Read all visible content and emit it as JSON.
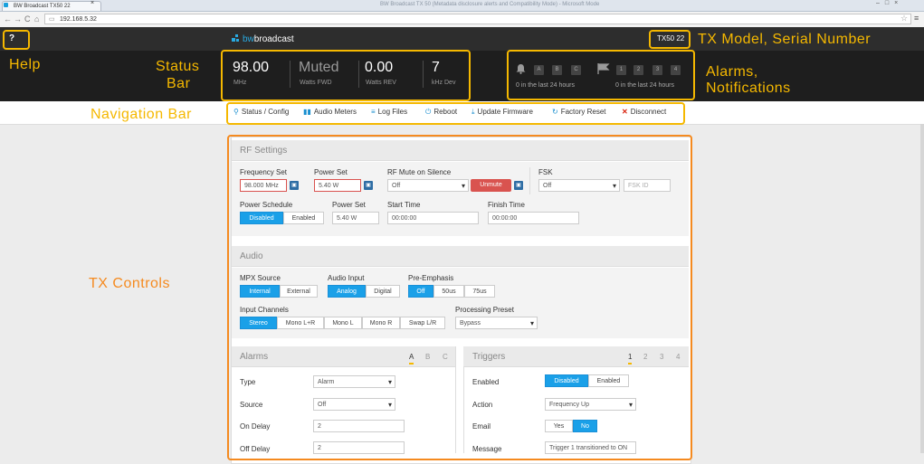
{
  "browser": {
    "tab_title": "BW Broadcast TX50 22",
    "window_title": "BW Broadcast TX 50 (Metadata disclosure alerts and Compatibility Mode) - Microsoft Mode",
    "url": "192.168.5.32",
    "back_glyph": "←",
    "forward_glyph": "→",
    "reload_glyph": "C",
    "home_glyph": "⌂",
    "close_glyph": "×",
    "window_controls": "–□×",
    "star_glyph": "☆",
    "menu_glyph": "≡"
  },
  "header": {
    "help_label": "?",
    "logo_prefix": "bw",
    "logo_suffix": "broadcast",
    "model_serial": "TX50 22"
  },
  "status_bar": {
    "frequency": {
      "value": "98.00",
      "unit": "MHz"
    },
    "forward": {
      "value": "Muted",
      "unit": "Watts FWD"
    },
    "reverse": {
      "value": "0.00",
      "unit": "Watts REV"
    },
    "deviation": {
      "value": "7",
      "unit": "kHz Dev"
    }
  },
  "alarms": {
    "bell_icon": "bell-icon",
    "labels": [
      "A",
      "B",
      "C"
    ],
    "text": "0 in the last 24 hours"
  },
  "notifications": {
    "flag_icon": "flag-icon",
    "labels": [
      "1",
      "2",
      "3",
      "4"
    ],
    "text": "0 in the last 24 hours"
  },
  "nav": {
    "items": [
      {
        "icon": "⚲",
        "label": "Status / Config"
      },
      {
        "icon": "▮▮",
        "label": "Audio Meters"
      },
      {
        "icon": "≡",
        "label": "Log Files"
      },
      {
        "icon": "⏻",
        "label": "Reboot"
      },
      {
        "icon": "⤓",
        "label": "Update Firmware"
      },
      {
        "icon": "↻",
        "label": "Factory Reset"
      },
      {
        "icon": "✕",
        "label": "Disconnect"
      }
    ]
  },
  "rf": {
    "title": "RF Settings",
    "frequency_set_label": "Frequency Set",
    "frequency_set_value": "98.000 MHz",
    "power_set_label": "Power Set",
    "power_set_value": "5.40 W",
    "rf_mute_label": "RF Mute on Silence",
    "rf_mute_value": "Off",
    "unmute_label": "Unmute",
    "fsk_label": "FSK",
    "fsk_value": "Off",
    "fsk_id_placeholder": "FSK ID",
    "power_schedule_label": "Power Schedule",
    "schedule_disabled": "Disabled",
    "schedule_enabled": "Enabled",
    "power_set2_label": "Power Set",
    "power_set2_value": "5.40 W",
    "start_time_label": "Start Time",
    "start_time_value": "00:00:00",
    "finish_time_label": "Finish Time",
    "finish_time_value": "00:00:00"
  },
  "audio": {
    "title": "Audio",
    "mpx_label": "MPX Source",
    "mpx_options": [
      "Internal",
      "External"
    ],
    "input_label": "Audio Input",
    "input_options": [
      "Analog",
      "Digital"
    ],
    "preemph_label": "Pre-Emphasis",
    "preemph_options": [
      "Off",
      "50us",
      "75us"
    ],
    "channels_label": "Input Channels",
    "channels_options": [
      "Stereo",
      "Mono L+R",
      "Mono L",
      "Mono R",
      "Swap L/R"
    ],
    "preset_label": "Processing Preset",
    "preset_value": "Bypass"
  },
  "alarms_panel": {
    "title": "Alarms",
    "tabs": [
      "A",
      "B",
      "C"
    ],
    "type_label": "Type",
    "type_value": "Alarm",
    "source_label": "Source",
    "source_value": "Off",
    "on_delay_label": "On Delay",
    "on_delay_value": "2",
    "off_delay_label": "Off Delay",
    "off_delay_value": "2"
  },
  "triggers_panel": {
    "title": "Triggers",
    "tabs": [
      "1",
      "2",
      "3",
      "4"
    ],
    "enabled_label": "Enabled",
    "enabled_options": [
      "Disabled",
      "Enabled"
    ],
    "action_label": "Action",
    "action_value": "Frequency Up",
    "email_label": "Email",
    "email_options": [
      "Yes",
      "No"
    ],
    "message_label": "Message",
    "message_value": "Trigger 1 transitioned to ON"
  },
  "annotations": {
    "help": "Help",
    "status_bar_line1": "Status",
    "status_bar_line2": "Bar",
    "model_serial": "TX Model, Serial Number",
    "alarms_line1": "Alarms,",
    "alarms_line2": "Notifications",
    "navigation": "Navigation Bar",
    "tx_controls": "TX Controls"
  },
  "colors": {
    "accent": "#1aa0e8",
    "annotation_yellow": "#f5b800",
    "annotation_orange": "#f58a1f",
    "danger": "#d9534f"
  }
}
